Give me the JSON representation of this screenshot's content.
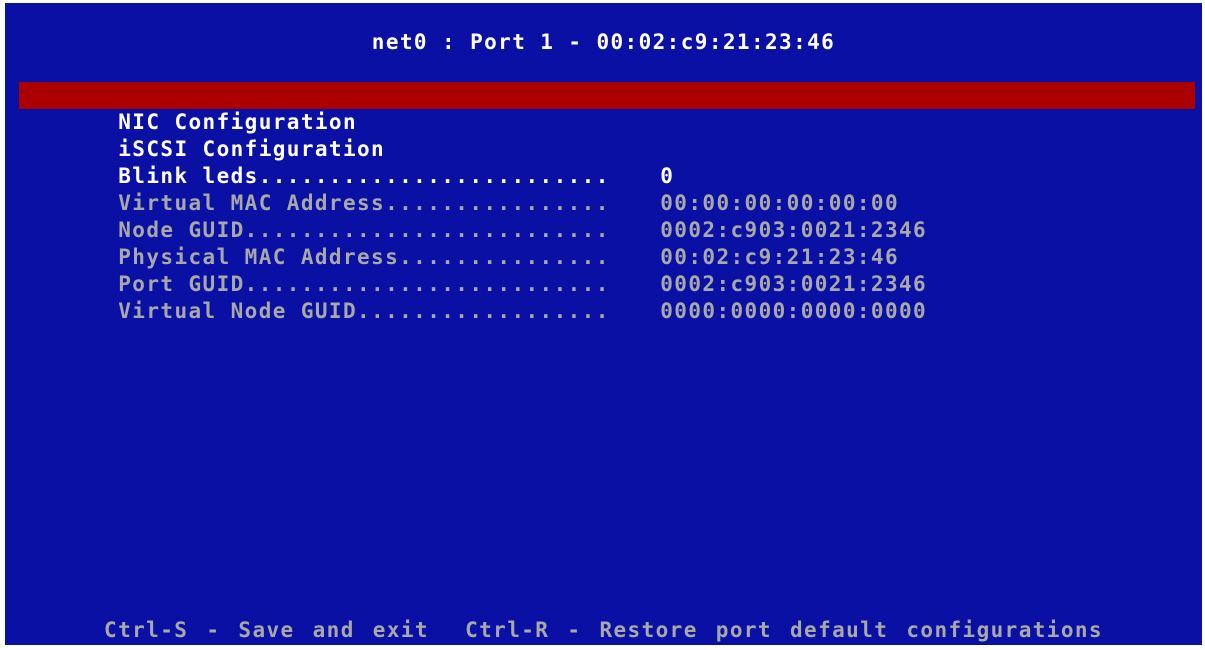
{
  "title": "net0 : Port 1 - 00:02:c9:21:23:46",
  "menu": [
    {
      "label": "NIC Configuration",
      "value": "",
      "state": "selected"
    },
    {
      "label": "iSCSI Configuration",
      "value": "",
      "state": "normal"
    },
    {
      "label": "Blink leds.........................",
      "value": "0",
      "state": "normal"
    },
    {
      "label": "Virtual MAC Address................",
      "value": "00:00:00:00:00:00",
      "state": "disabled"
    },
    {
      "label": "Node GUID..........................",
      "value": "0002:c903:0021:2346",
      "state": "disabled"
    },
    {
      "label": "Physical MAC Address...............",
      "value": "00:02:c9:21:23:46",
      "state": "disabled"
    },
    {
      "label": "Port GUID..........................",
      "value": "0002:c903:0021:2346",
      "state": "disabled"
    },
    {
      "label": "Virtual Node GUID..................",
      "value": "0000:0000:0000:0000",
      "state": "disabled"
    }
  ],
  "footer": "Ctrl-S - Save and exit  Ctrl-R - Restore port default configurations",
  "colors": {
    "background": "#0a10a3",
    "highlight": "#aa0000",
    "text": "#ffffff",
    "dim_text": "#a8a8a8"
  }
}
